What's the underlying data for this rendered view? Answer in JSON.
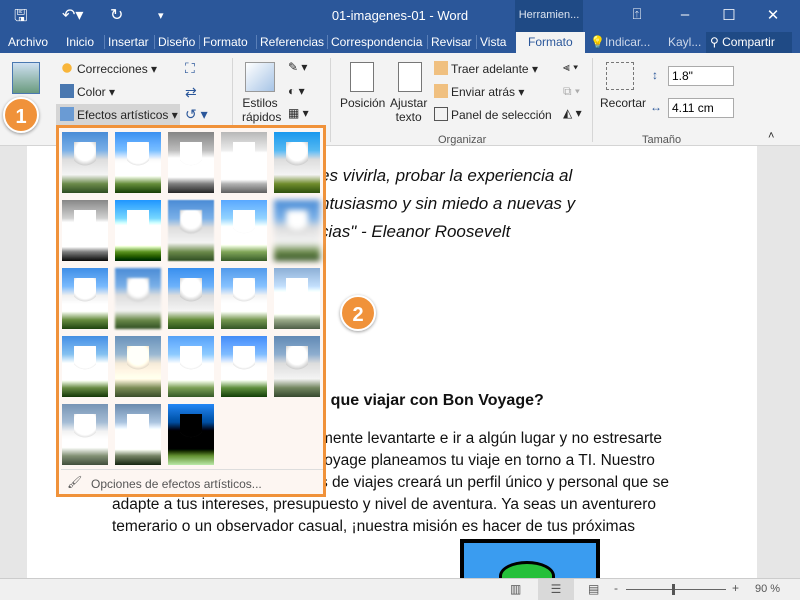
{
  "window": {
    "title": "01-imagenes-01  -  Word",
    "context_tab": "Herramien..."
  },
  "tabs": [
    "Archivo",
    "Inicio",
    "Insertar",
    "Diseño",
    "Formato",
    "Referencias",
    "Correspondencia",
    "Revisar",
    "Vista",
    "Formato"
  ],
  "tell_me": "Indicar...",
  "user": "Kayl...",
  "share": "Compartir",
  "ribbon": {
    "corrections": "Correcciones",
    "color": "Color",
    "artistic": "Efectos artísticos",
    "quick_styles_1": "Estilos",
    "quick_styles_2": "rápidos",
    "position": "Posición",
    "wrap_1": "Ajustar",
    "wrap_2": "texto",
    "bring_forward": "Traer adelante",
    "send_backward": "Enviar atrás",
    "selection_pane": "Panel de selección",
    "crop": "Recortar",
    "height": "1.8\"",
    "width": "4.11 cm",
    "group_arrange": "Organizar",
    "group_size": "Tamaño"
  },
  "gallery": {
    "rows": [
      5,
      5,
      5,
      5,
      3
    ],
    "options": "Opciones de efectos artísticos..."
  },
  "badges": [
    "1",
    "2"
  ],
  "document": {
    "lines": [
      "es vivirla, probar la experiencia al",
      "ntusiasmo y sin miedo a nuevas y",
      "cias\" - Eleanor Roosevelt"
    ],
    "heading": "r que viajar con Bon Voyage?",
    "body": [
      "mente  levantarte e ir a algún lugar y no estresarte",
      "/oyage planeamos tu viaje en torno a TI. Nuestro",
      "s de viajes creará un perfil único y personal que se",
      "adapte a tus intereses, presupuesto y nivel de aventura. Ya seas un aventurero",
      "temerario o un observador casual, ¡nuestra misión es hacer de tus próximas"
    ]
  },
  "status": {
    "zoom": "90 %",
    "zoom_level": 90
  },
  "colors": {
    "accent": "#2b579a",
    "highlight": "#f0923a"
  }
}
